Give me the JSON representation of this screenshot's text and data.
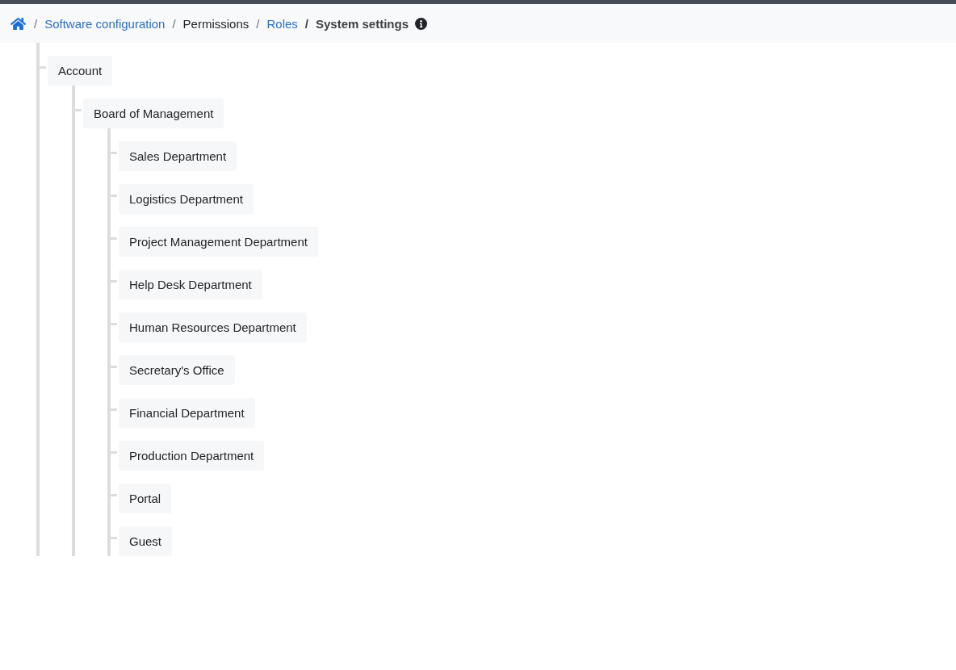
{
  "breadcrumb": {
    "items": [
      {
        "label": "Software configuration",
        "kind": "link",
        "separator": "/"
      },
      {
        "label": "Permissions",
        "kind": "text",
        "separator": "/"
      },
      {
        "label": "Roles",
        "kind": "link",
        "separator": "/"
      },
      {
        "label": "System settings",
        "kind": "current",
        "separator": "/"
      }
    ]
  },
  "tree": {
    "nodes": [
      {
        "label": "Account",
        "children": [
          {
            "label": "Board of Management",
            "children": [
              {
                "label": "Sales Department"
              },
              {
                "label": "Logistics Department"
              },
              {
                "label": "Project Management Department"
              },
              {
                "label": "Help Desk Department"
              },
              {
                "label": "Human Resources Department"
              },
              {
                "label": "Secretary's Office"
              },
              {
                "label": "Financial Department"
              },
              {
                "label": "Production Department"
              },
              {
                "label": "Portal"
              },
              {
                "label": "Guest"
              }
            ]
          }
        ]
      }
    ]
  }
}
